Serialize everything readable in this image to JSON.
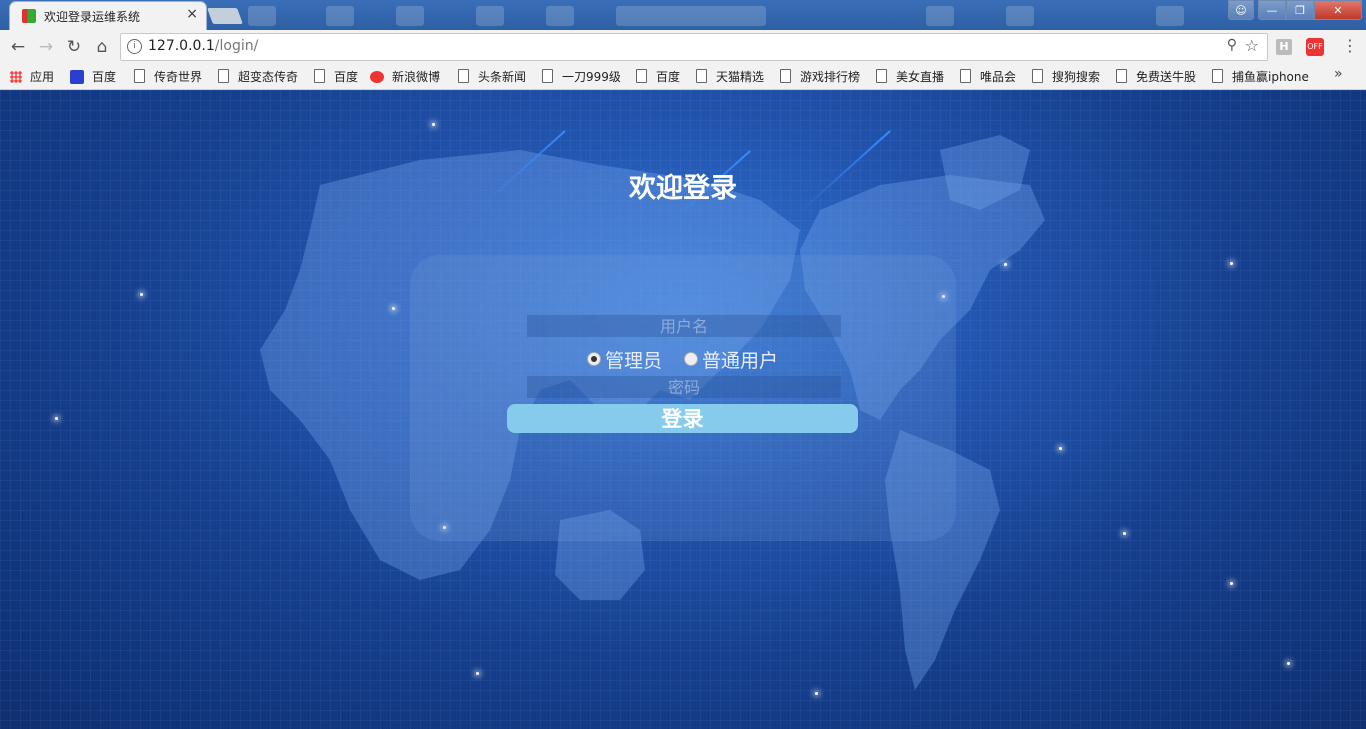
{
  "browser": {
    "tab_title": "欢迎登录运维系统",
    "tab_close": "×",
    "url_host": "127.0.0.1",
    "url_path": "/login/",
    "ext_h": "H",
    "ext_off": "OFF"
  },
  "bookmarks": [
    "应用",
    "百度",
    "传奇世界",
    "超变态传奇",
    "百度",
    "新浪微博",
    "头条新闻",
    "一刀999级",
    "百度",
    "天猫精选",
    "游戏排行榜",
    "美女直播",
    "唯品会",
    "搜狗搜索",
    "免费送牛股",
    "捕鱼赢iphone"
  ],
  "login": {
    "title": "欢迎登录",
    "username_placeholder": "用户名",
    "password_placeholder": "密码",
    "role_admin": "管理员",
    "role_user": "普通用户",
    "role_selected": "管理员",
    "submit_label": "登录"
  },
  "colors": {
    "background": "#1d4f9b",
    "button": "#86cbeb"
  }
}
